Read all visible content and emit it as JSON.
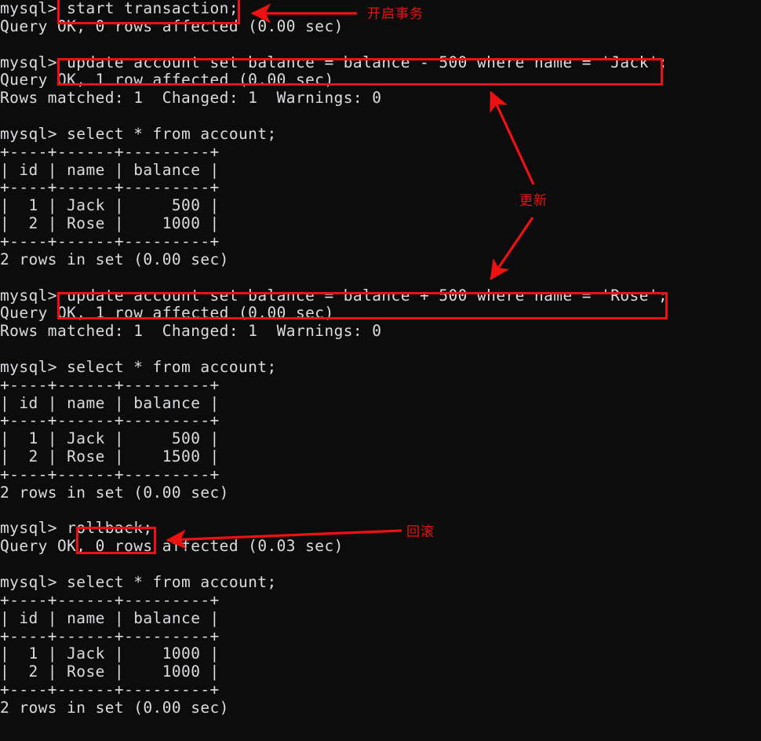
{
  "terminal": {
    "prompt": "mysql>",
    "background_color": "#0d0c0c",
    "text_color": "#d9dde0",
    "annotation_color": "#ee1111",
    "lines": [
      "mysql> start transaction;",
      "Query OK, 0 rows affected (0.00 sec)",
      "",
      "mysql> update account set balance = balance - 500 where name = 'Jack';",
      "Query OK, 1 row affected (0.00 sec)",
      "Rows matched: 1  Changed: 1  Warnings: 0",
      "",
      "mysql> select * from account;",
      "+----+------+---------+",
      "| id | name | balance |",
      "+----+------+---------+",
      "|  1 | Jack |     500 |",
      "|  2 | Rose |    1000 |",
      "+----+------+---------+",
      "2 rows in set (0.00 sec)",
      "",
      "mysql> update account set balance = balance + 500 where name = 'Rose';",
      "Query OK, 1 row affected (0.00 sec)",
      "Rows matched: 1  Changed: 1  Warnings: 0",
      "",
      "mysql> select * from account;",
      "+----+------+---------+",
      "| id | name | balance |",
      "+----+------+---------+",
      "|  1 | Jack |     500 |",
      "|  2 | Rose |    1500 |",
      "+----+------+---------+",
      "2 rows in set (0.00 sec)",
      "",
      "mysql> rollback;",
      "Query OK, 0 rows affected (0.03 sec)",
      "",
      "mysql> select * from account;",
      "+----+------+---------+",
      "| id | name | balance |",
      "+----+------+---------+",
      "|  1 | Jack |    1000 |",
      "|  2 | Rose |    1000 |",
      "+----+------+---------+",
      "2 rows in set (0.00 sec)"
    ]
  },
  "annotations": {
    "labels": [
      {
        "id": "start-transaction",
        "text": "开启事务"
      },
      {
        "id": "update",
        "text": "更新"
      },
      {
        "id": "rollback",
        "text": "回滚"
      }
    ]
  },
  "tables": [
    {
      "id": "account-after-debit",
      "columns": [
        "id",
        "name",
        "balance"
      ],
      "rows": [
        [
          "1",
          "Jack",
          "500"
        ],
        [
          "2",
          "Rose",
          "1000"
        ]
      ],
      "footer": "2 rows in set (0.00 sec)"
    },
    {
      "id": "account-after-credit",
      "columns": [
        "id",
        "name",
        "balance"
      ],
      "rows": [
        [
          "1",
          "Jack",
          "500"
        ],
        [
          "2",
          "Rose",
          "1500"
        ]
      ],
      "footer": "2 rows in set (0.00 sec)"
    },
    {
      "id": "account-after-rollback",
      "columns": [
        "id",
        "name",
        "balance"
      ],
      "rows": [
        [
          "1",
          "Jack",
          "1000"
        ],
        [
          "2",
          "Rose",
          "1000"
        ]
      ],
      "footer": "2 rows in set (0.00 sec)"
    }
  ]
}
